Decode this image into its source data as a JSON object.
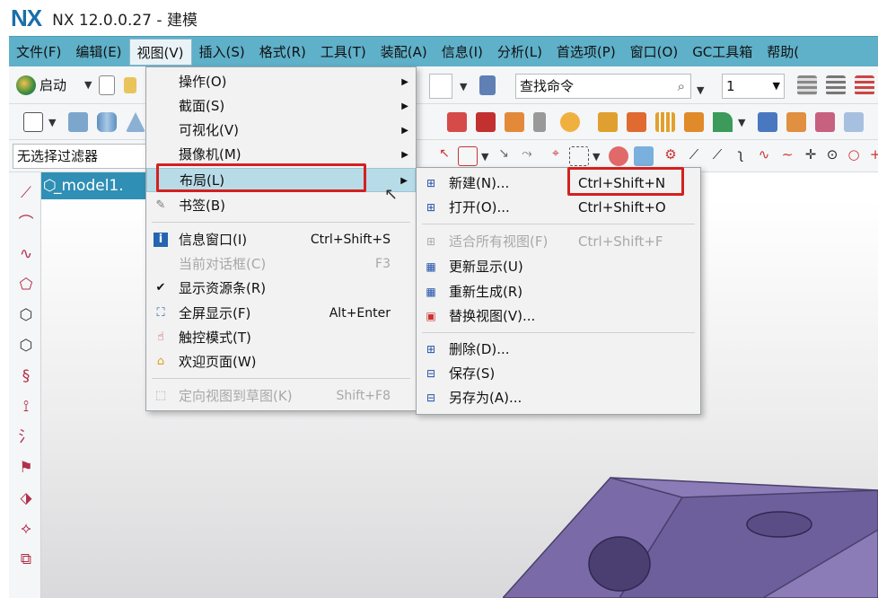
{
  "titlebar": {
    "logo": "NX",
    "title": "NX 12.0.0.27 - 建模"
  },
  "menubar": [
    {
      "label": "文件(F)"
    },
    {
      "label": "编辑(E)"
    },
    {
      "label": "视图(V)"
    },
    {
      "label": "插入(S)"
    },
    {
      "label": "格式(R)"
    },
    {
      "label": "工具(T)"
    },
    {
      "label": "装配(A)"
    },
    {
      "label": "信息(I)"
    },
    {
      "label": "分析(L)"
    },
    {
      "label": "首选项(P)"
    },
    {
      "label": "窗口(O)"
    },
    {
      "label": "GC工具箱"
    },
    {
      "label": "帮助("
    }
  ],
  "toolbar": {
    "start_label": "启动",
    "command_finder_placeholder": "查找命令",
    "layer_value": "1",
    "selection_filter": "无选择过滤器"
  },
  "doc_tab": {
    "label": "_model1."
  },
  "view_menu": {
    "items": [
      {
        "label": "操作(O)",
        "has_submenu": true
      },
      {
        "label": "截面(S)",
        "has_submenu": true
      },
      {
        "label": "可视化(V)",
        "has_submenu": true
      },
      {
        "label": "摄像机(M)",
        "has_submenu": true
      },
      {
        "label": "布局(L)",
        "has_submenu": true,
        "highlighted": true
      },
      {
        "label": "书签(B)"
      },
      {
        "label": "信息窗口(I)",
        "shortcut": "Ctrl+Shift+S"
      },
      {
        "label": "当前对话框(C)",
        "shortcut": "F3",
        "disabled": true
      },
      {
        "label": "显示资源条(R)",
        "checked": true
      },
      {
        "label": "全屏显示(F)",
        "shortcut": "Alt+Enter"
      },
      {
        "label": "触控模式(T)"
      },
      {
        "label": "欢迎页面(W)"
      },
      {
        "label": "定向视图到草图(K)",
        "shortcut": "Shift+F8",
        "disabled": true
      }
    ]
  },
  "layout_submenu": {
    "items": [
      {
        "label": "新建(N)...",
        "shortcut": "Ctrl+Shift+N"
      },
      {
        "label": "打开(O)...",
        "shortcut": "Ctrl+Shift+O"
      },
      {
        "label": "适合所有视图(F)",
        "shortcut": "Ctrl+Shift+F",
        "disabled": true
      },
      {
        "label": "更新显示(U)"
      },
      {
        "label": "重新生成(R)"
      },
      {
        "label": "替换视图(V)..."
      },
      {
        "label": "删除(D)..."
      },
      {
        "label": "保存(S)"
      },
      {
        "label": "另存为(A)..."
      }
    ]
  },
  "colors": {
    "menubar": "#5fb0c9",
    "highlight": "#b8dbe8",
    "annotation_red": "#d42020",
    "part_face": "#8b7cb8"
  }
}
